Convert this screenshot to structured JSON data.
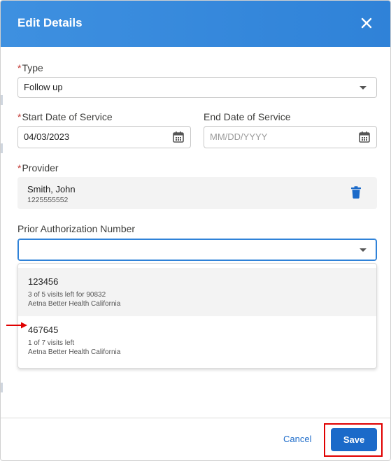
{
  "modal": {
    "title": "Edit Details"
  },
  "type_field": {
    "required_mark": "*",
    "label": "Type",
    "value": "Follow up"
  },
  "start_date": {
    "required_mark": "*",
    "label": "Start Date of Service",
    "value": "04/03/2023"
  },
  "end_date": {
    "label": "End Date of Service",
    "placeholder": "MM/DD/YYYY"
  },
  "provider": {
    "required_mark": "*",
    "label": "Provider",
    "name": "Smith, John",
    "id": "1225555552"
  },
  "prior_auth": {
    "label": "Prior Authorization Number",
    "value": "",
    "options": [
      {
        "number": "123456",
        "visits": "3 of 5 visits left for 90832",
        "payer": "Aetna Better Health California"
      },
      {
        "number": "467645",
        "visits": "1 of 7 visits left",
        "payer": "Aetna Better Health California"
      }
    ]
  },
  "footer": {
    "cancel_label": "Cancel",
    "save_label": "Save"
  },
  "colors": {
    "header": "#3e90e0",
    "primary": "#1b6ac9",
    "required": "#c23934",
    "annotation": "#e00000"
  },
  "icons": [
    "close-icon",
    "calendar-icon",
    "chevron-down-icon",
    "trash-icon",
    "arrow-right-icon"
  ]
}
